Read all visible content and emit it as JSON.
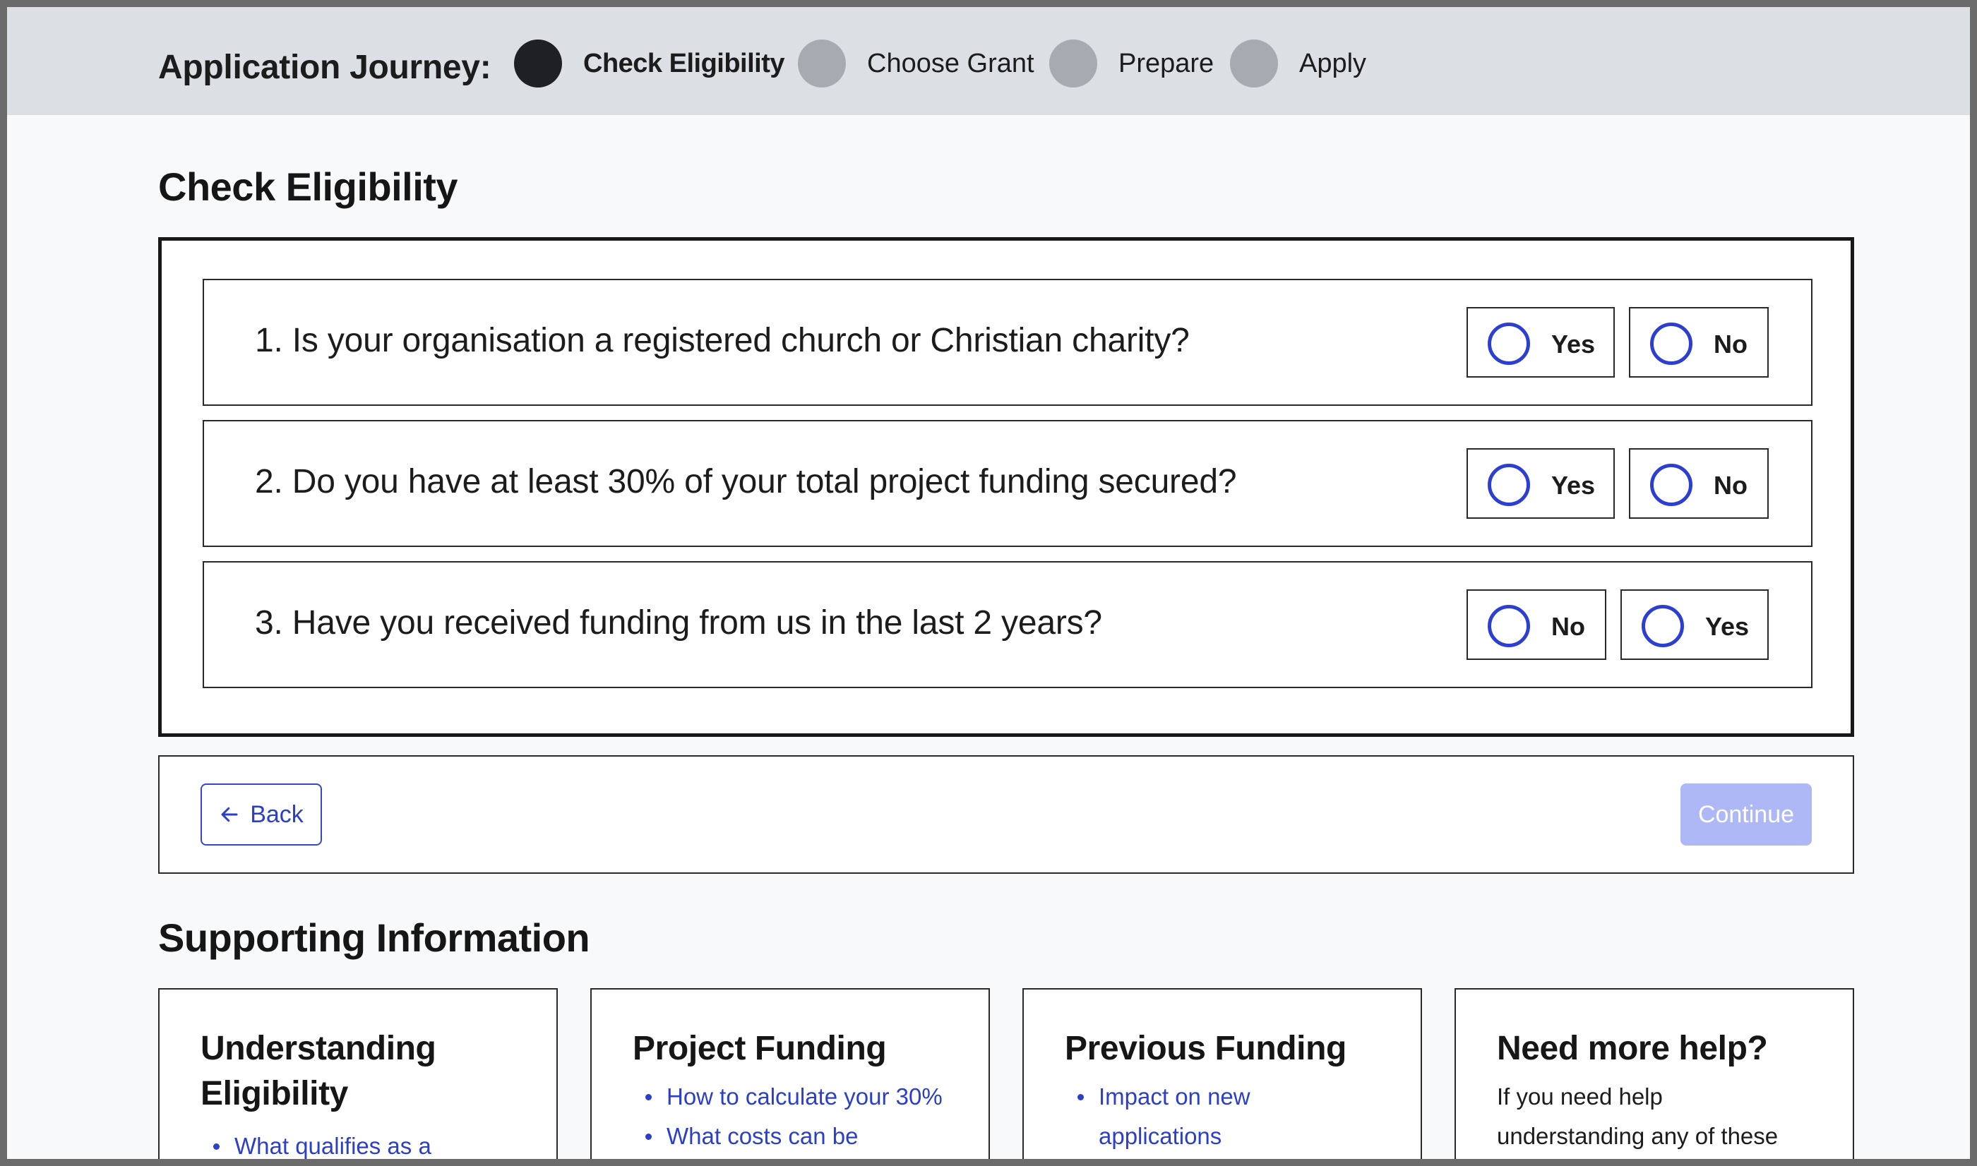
{
  "journey": {
    "title": "Application Journey:",
    "steps": [
      {
        "label": "Check Eligibility",
        "state": "active"
      },
      {
        "label": "Choose Grant",
        "state": "upcoming"
      },
      {
        "label": "Prepare",
        "state": "upcoming"
      },
      {
        "label": "Apply",
        "state": "upcoming"
      }
    ]
  },
  "eligibility": {
    "heading": "Check Eligibility",
    "questions": [
      {
        "text": "1. Is your organisation a registered church or Christian charity?",
        "options": [
          "Yes",
          "No"
        ],
        "selected": null
      },
      {
        "text": "2. Do you have at least 30% of your total project funding secured?",
        "options": [
          "Yes",
          "No"
        ],
        "selected": null
      },
      {
        "text": "3. Have you received funding from us in the last 2 years?",
        "options": [
          "No",
          "Yes"
        ],
        "selected": null
      }
    ]
  },
  "nav": {
    "back_label": "Back",
    "continue_label": "Continue",
    "continue_enabled": false
  },
  "support": {
    "heading": "Supporting Information",
    "cards": [
      {
        "title": "Understanding Eligibility",
        "links": [
          "What qualifies as a"
        ]
      },
      {
        "title": "Project Funding",
        "links": [
          "How to calculate your 30%",
          "What costs can be"
        ]
      },
      {
        "title": "Previous Funding",
        "links": [
          "Impact on new applications"
        ]
      },
      {
        "title": "Need more help?",
        "text": "If you need help understanding any of these"
      }
    ]
  },
  "colors": {
    "accent": "#2d3fd0",
    "continue_disabled": "#aeb8f7",
    "journey_bar": "#dcdfe3",
    "step_active": "#1f2023",
    "step_inactive": "#a7abb1"
  },
  "icons": {
    "back": "arrow-left-icon",
    "radio": "radio-unchecked-icon",
    "step": "step-circle-icon",
    "bullet": "bullet-icon"
  }
}
